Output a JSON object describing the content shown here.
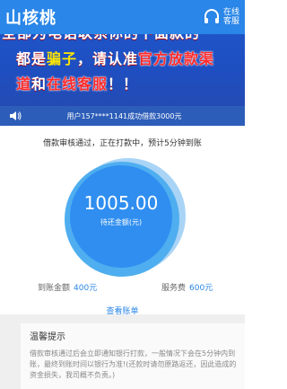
{
  "header": {
    "title": "山核桃",
    "cs_label": "在线客服"
  },
  "banner": {
    "line1": "全部为电话联系你的下面款的",
    "line2_a": "都是",
    "line2_b": "骗子",
    "line2_c": "，请认准",
    "line2_d": "官方放款渠",
    "line3_a": "道",
    "line3_b": "和",
    "line3_c": "在线客服",
    "line3_d": "！！"
  },
  "notice": {
    "text": "用户157****1141成功借款3000元"
  },
  "status_text": "借款审核通过，正在打款中，预计5分钟到账",
  "loan": {
    "amount": "1005.00",
    "amount_label": "待还金额(元)"
  },
  "fees": {
    "arrival_label": "到账金额",
    "arrival_value": "400元",
    "service_label": "服务费",
    "service_value": "600元"
  },
  "view_bill": "查看账单",
  "tips": {
    "title": "温馨提示",
    "body": "借款审核通过后会立即通知银行打款，一般情况下会在5分钟内到账，最终到账时间以银行为准!(还款时请勿原路返还，因此造成的资金损失，我司概不负责。)"
  }
}
